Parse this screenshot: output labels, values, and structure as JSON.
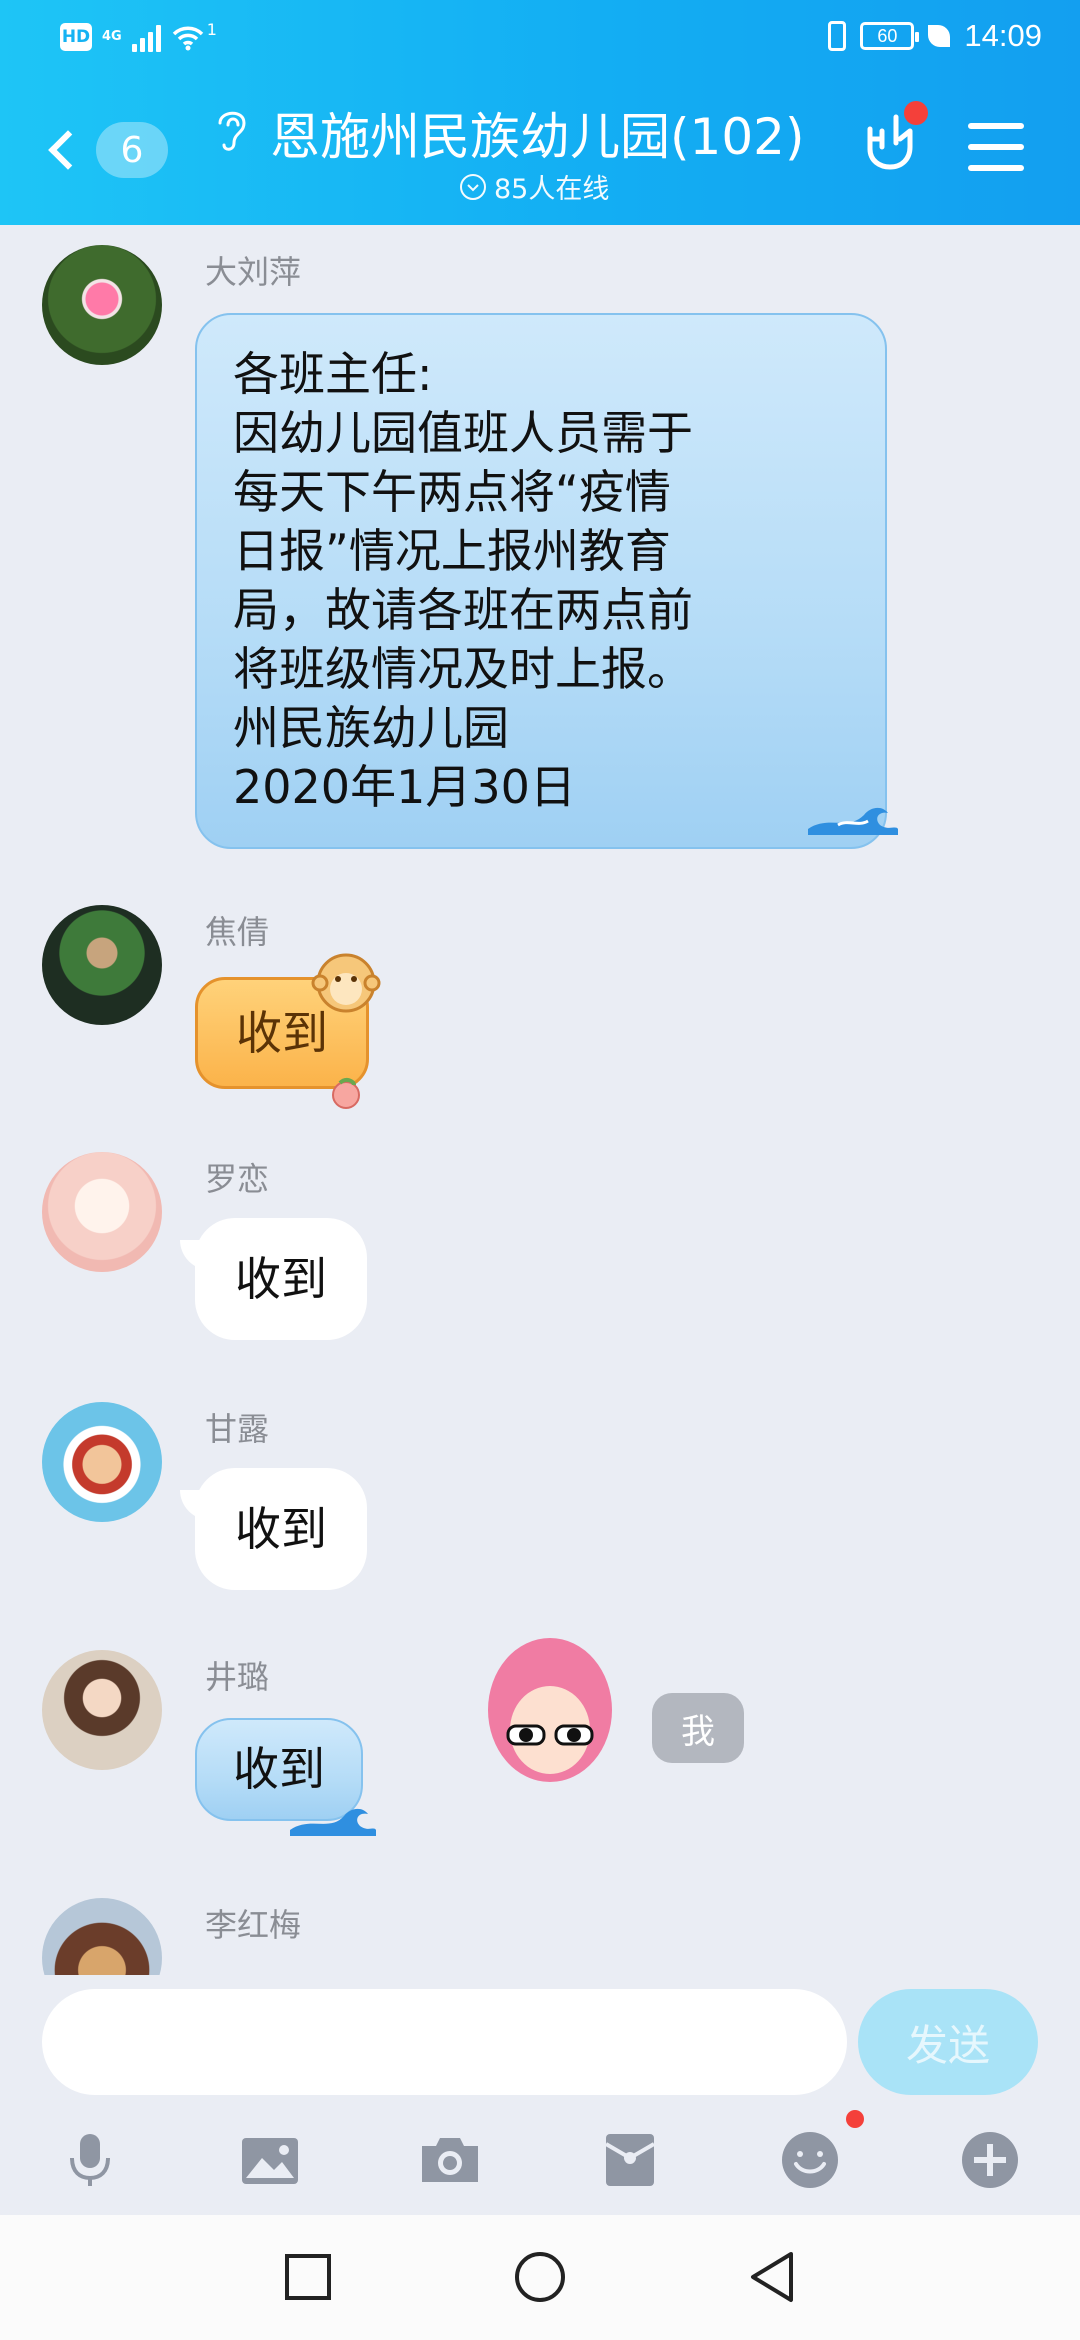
{
  "status_bar": {
    "hd": "HD",
    "network": "4G",
    "signal_sup": "1",
    "battery": "60",
    "time": "14:09"
  },
  "header": {
    "back_count": "6",
    "title": "恩施州民族幼儿园(102)",
    "online": "85人在线"
  },
  "messages": [
    {
      "sender": "大刘萍",
      "style": "blue",
      "lines": [
        "各班主任:",
        "因幼儿园值班人员需于",
        "每天下午两点将“疫情",
        "日报”情况上报州教育",
        "局，故请各班在两点前",
        "将班级情况及时上报。",
        "州民族幼儿园",
        "2020年1月30日"
      ]
    },
    {
      "sender": "焦倩",
      "style": "orange",
      "text": "收到"
    },
    {
      "sender": "罗恋",
      "style": "white",
      "text": "收到"
    },
    {
      "sender": "甘露",
      "style": "white",
      "text": "收到"
    },
    {
      "sender": "井璐",
      "style": "blue",
      "text": "收到"
    },
    {
      "sender": "李红梅",
      "style": "sticker"
    }
  ],
  "me_label": "我",
  "input": {
    "placeholder": "",
    "send_label": "发送"
  },
  "toolbar": [
    "mic-icon",
    "image-icon",
    "camera-icon",
    "red-packet-icon",
    "emoji-icon",
    "plus-icon"
  ],
  "navbar": [
    "square-icon",
    "circle-icon",
    "back-triangle-icon"
  ],
  "colors": {
    "header_start": "#1ec5f6",
    "header_end": "#139ff0",
    "chat_bg": "#eaedf4",
    "blue_bubble": "#b5dcf7",
    "send_button": "#a9e3f7",
    "notification_dot": "#f4403a"
  }
}
